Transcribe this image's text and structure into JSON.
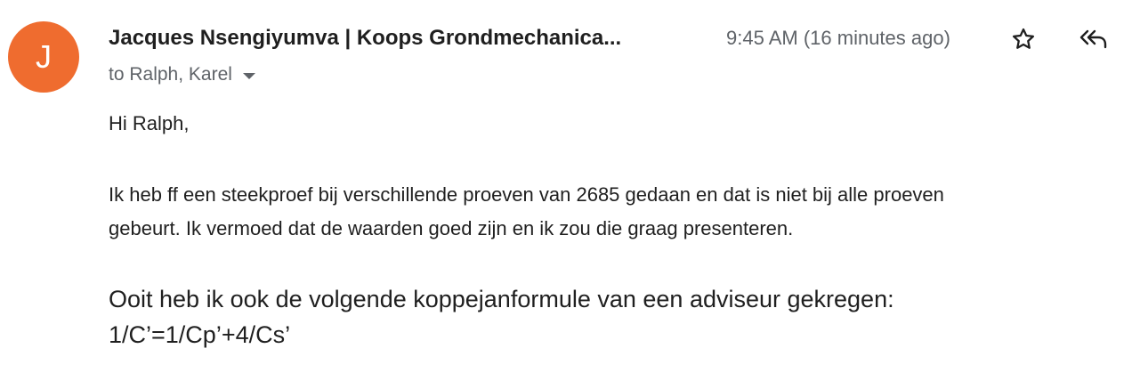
{
  "email": {
    "avatar_letter": "J",
    "avatar_color": "#ef6c2f",
    "sender": "Jacques Nsengiyumva | Koops Grondmechanica...",
    "time": "9:45 AM (16 minutes ago)",
    "recipients": "to Ralph, Karel",
    "actions": {
      "star_icon": "star-outline-icon",
      "reply_all_icon": "reply-all-icon"
    },
    "body": {
      "greeting": "Hi Ralph,",
      "paragraph1_lines": [
        "Ik heb ff een steekproef bij verschillende proeven van 2685 gedaan en dat is niet bij alle proeven",
        "gebeurt. Ik vermoed dat de waarden goed zijn en ik zou die graag presenteren."
      ],
      "paragraph2_lines": [
        "Ooit heb ik ook de volgende koppejanformule van een adviseur gekregen:",
        "1/C’=1/Cp’+4/Cs’"
      ]
    }
  }
}
